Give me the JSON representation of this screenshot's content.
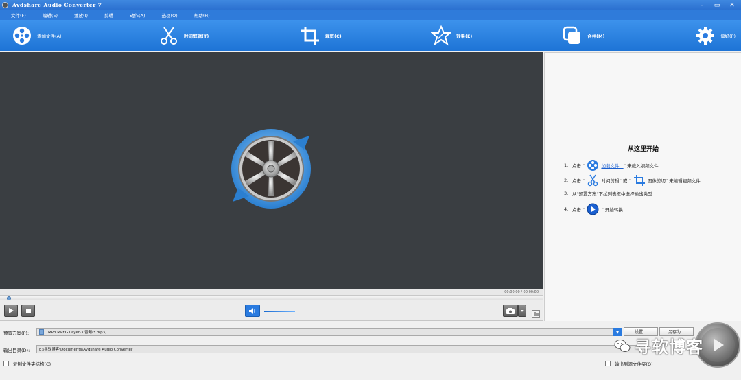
{
  "window": {
    "title": "Avdshare Audio Converter 7",
    "controls": {
      "minimize": "–",
      "restore": "▭",
      "close": "✕"
    }
  },
  "menu": [
    "文件(F)",
    "编辑(E)",
    "播放(I)",
    "剪辑",
    "动作(A)",
    "选项(O)",
    "帮助(H)"
  ],
  "toolbar": {
    "add_file": "添加文件(A)",
    "trim": "时间剪辑(T)",
    "crop": "裁剪(C)",
    "effect": "效果(E)",
    "merge": "合并(M)",
    "settings": "偏好(P)"
  },
  "player": {
    "time": "00:00:00 / 00:00:00"
  },
  "guide": {
    "title": "从这里开始",
    "step1": {
      "num": "1.",
      "pre": "点击 “",
      "link": "加载文件...",
      "post": "” 来载入视频文件."
    },
    "step2": {
      "num": "2.",
      "pre": "点击 “",
      "mid1": "时间剪辑",
      "mid2": "” 或 “",
      "post": "图像剪切” 来编辑视频文件."
    },
    "step3": {
      "num": "3.",
      "text": "从\"预置方案\"下拉列表框中选择输出类型."
    },
    "step4": {
      "num": "4.",
      "pre": "点击 “",
      "post": "” 开始转换."
    }
  },
  "output": {
    "profile_label": "预置方案(P):",
    "profile_value": "MP3 MPEG Layer-3 音频(*.mp3)",
    "settings_button": "设置...",
    "save_as_button": "另存为...",
    "dir_label": "输出目录(D):",
    "dir_value": "E:\\寻软博客\\Documents\\Avdshare Audio Converter",
    "copy_structure": "复制文件夹结构(C)",
    "output_to_source": "输出到源文件夹(O)"
  },
  "watermark": {
    "text": "寻软博客"
  },
  "colors": {
    "toolbar_blue": "#2a7be0",
    "preview_bg": "#3a3e42",
    "accent": "#1a5fd0"
  }
}
